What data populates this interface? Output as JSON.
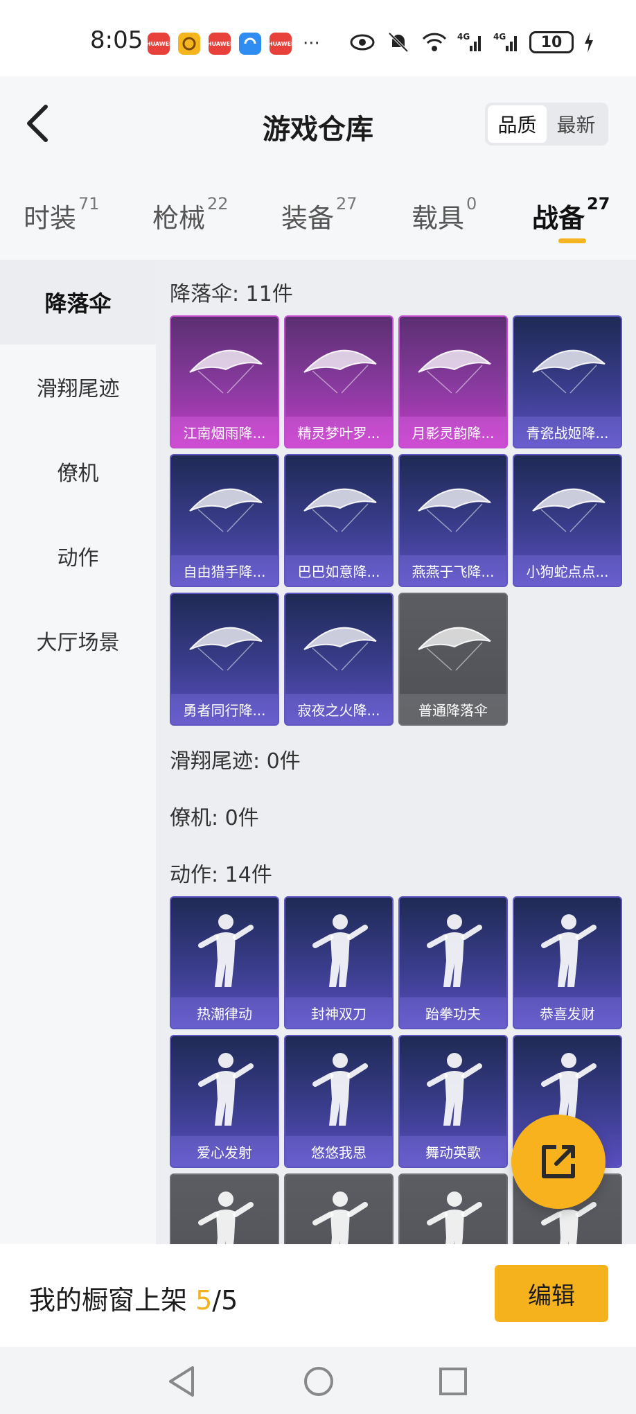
{
  "status_bar": {
    "time": "8:05",
    "app_icons": [
      {
        "name": "huawei-appgallery-icon",
        "label": "HUAWEI",
        "color": "#e8413c"
      },
      {
        "name": "game-center-icon",
        "label": "",
        "color": "#f5b51e"
      },
      {
        "name": "huawei-appgallery-icon",
        "label": "HUAWEI",
        "color": "#e8413c"
      },
      {
        "name": "browser-icon",
        "label": "",
        "color": "#2f8cf0"
      },
      {
        "name": "huawei-appgallery-icon",
        "label": "HUAWEI",
        "color": "#e8413c"
      }
    ],
    "more": "···",
    "battery": "10"
  },
  "header": {
    "title": "游戏仓库",
    "sort_options": [
      "品质",
      "最新"
    ],
    "sort_active": "品质"
  },
  "tabs": [
    {
      "label": "时装",
      "count": "71"
    },
    {
      "label": "枪械",
      "count": "22"
    },
    {
      "label": "装备",
      "count": "27"
    },
    {
      "label": "载具",
      "count": "0"
    },
    {
      "label": "战备",
      "count": "27"
    }
  ],
  "active_tab": "战备",
  "sidebar": {
    "items": [
      "降落伞",
      "滑翔尾迹",
      "僚机",
      "动作",
      "大厅场景"
    ],
    "active": "降落伞"
  },
  "sections": {
    "parachute": {
      "title": "降落伞: 11件",
      "items": [
        {
          "name": "江南烟雨降...",
          "rarity": "pink"
        },
        {
          "name": "精灵梦叶罗...",
          "rarity": "pink"
        },
        {
          "name": "月影灵韵降...",
          "rarity": "pink"
        },
        {
          "name": "青瓷战姬降...",
          "rarity": "purple"
        },
        {
          "name": "自由猎手降...",
          "rarity": "purple"
        },
        {
          "name": "巴巴如意降...",
          "rarity": "purple"
        },
        {
          "name": "燕燕于飞降...",
          "rarity": "purple"
        },
        {
          "name": "小狗蛇点点...",
          "rarity": "purple"
        },
        {
          "name": "勇者同行降...",
          "rarity": "purple"
        },
        {
          "name": "寂夜之火降...",
          "rarity": "purple"
        },
        {
          "name": "普通降落伞",
          "rarity": "gray"
        }
      ]
    },
    "glide_trail": {
      "title": "滑翔尾迹: 0件"
    },
    "wingman": {
      "title": "僚机: 0件"
    },
    "emote": {
      "title": "动作: 14件",
      "items": [
        {
          "name": "热潮律动",
          "rarity": "purple"
        },
        {
          "name": "封神双刀",
          "rarity": "purple"
        },
        {
          "name": "跆拳功夫",
          "rarity": "purple"
        },
        {
          "name": "恭喜发财",
          "rarity": "purple"
        },
        {
          "name": "爱心发射",
          "rarity": "purple"
        },
        {
          "name": "悠悠我思",
          "rarity": "purple"
        },
        {
          "name": "舞动英歌",
          "rarity": "purple"
        },
        {
          "name": "",
          "rarity": "purple"
        },
        {
          "name": "",
          "rarity": "gray"
        },
        {
          "name": "",
          "rarity": "gray"
        },
        {
          "name": "",
          "rarity": "gray"
        },
        {
          "name": "",
          "rarity": "gray"
        }
      ]
    }
  },
  "bottom": {
    "showcase_label": "我的橱窗上架",
    "showcase_current": "5",
    "showcase_total": "/5",
    "edit_label": "编辑"
  },
  "colors": {
    "accent": "#f6b21c",
    "pink_rarity": "#c23cc6",
    "purple_rarity": "#5a4fc0",
    "gray_rarity": "#5b5d62"
  }
}
